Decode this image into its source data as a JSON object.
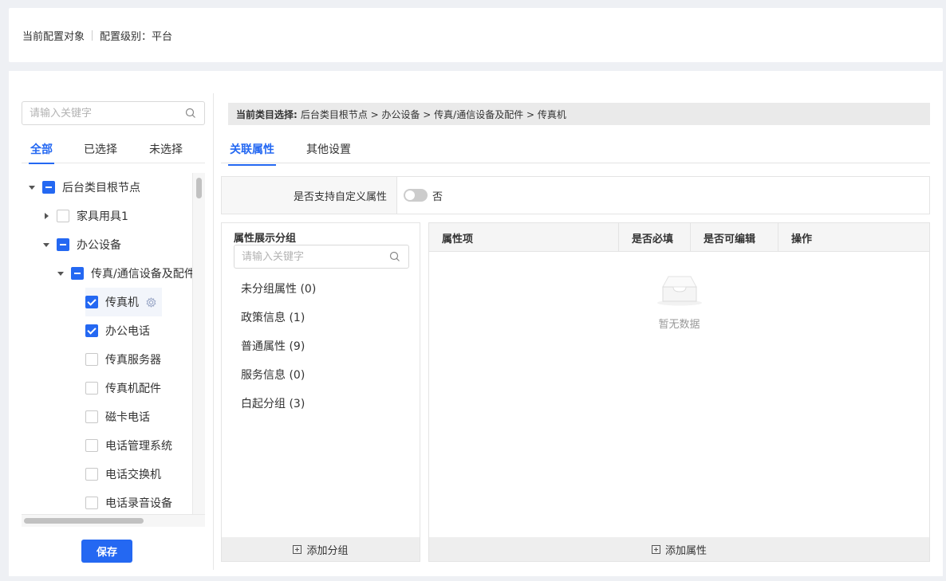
{
  "header": {
    "config_target": "当前配置对象",
    "config_level": "配置级别：平台"
  },
  "left": {
    "search_placeholder": "请输入关键字",
    "tabs": [
      "全部",
      "已选择",
      "未选择"
    ],
    "tree": [
      {
        "label": "后台类目根节点",
        "state": "partial",
        "caret": "down"
      },
      {
        "label": "家具用具1",
        "state": "unchecked",
        "caret": "right"
      },
      {
        "label": "办公设备",
        "state": "partial",
        "caret": "down"
      },
      {
        "label": "传真/通信设备及配件",
        "state": "partial",
        "caret": "down"
      },
      {
        "label": "传真机",
        "state": "checked",
        "caret": "none"
      },
      {
        "label": "办公电话",
        "state": "checked",
        "caret": "none"
      },
      {
        "label": "传真服务器",
        "state": "unchecked",
        "caret": "none"
      },
      {
        "label": "传真机配件",
        "state": "unchecked",
        "caret": "none"
      },
      {
        "label": "磁卡电话",
        "state": "unchecked",
        "caret": "none"
      },
      {
        "label": "电话管理系统",
        "state": "unchecked",
        "caret": "none"
      },
      {
        "label": "电话交换机",
        "state": "unchecked",
        "caret": "none"
      },
      {
        "label": "电话录音设备",
        "state": "unchecked",
        "caret": "none"
      }
    ],
    "save_label": "保存"
  },
  "right": {
    "breadcrumb_prefix": "当前类目选择:",
    "breadcrumb_path": "后台类目根节点 > 办公设备 > 传真/通信设备及配件 > 传真机",
    "tabs": [
      "关联属性",
      "其他设置"
    ],
    "custom_attr_label": "是否支持自定义属性",
    "custom_attr_value": "否",
    "group_panel": {
      "title": "属性展示分组",
      "search_placeholder": "请输入关键字",
      "items": [
        "未分组属性 (0)",
        "政策信息 (1)",
        "普通属性 (9)",
        "服务信息 (0)",
        "白起分组 (3)"
      ],
      "add_label": "添加分组"
    },
    "attr_panel": {
      "columns": [
        "属性项",
        "是否必填",
        "是否可编辑",
        "操作"
      ],
      "empty_text": "暂无数据",
      "add_label": "添加属性"
    }
  },
  "colors": {
    "accent": "#2468f2",
    "background": "#eef0f4"
  }
}
